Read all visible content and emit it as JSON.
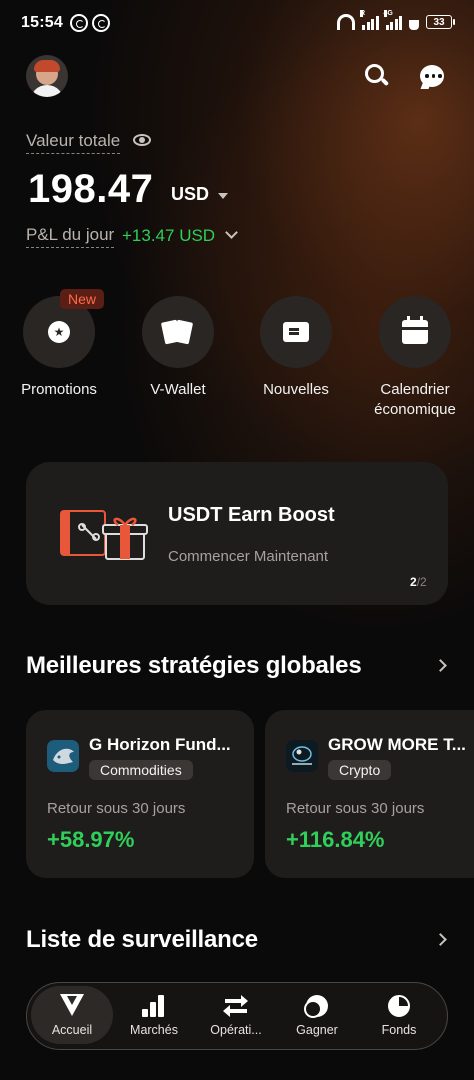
{
  "status_bar": {
    "time": "15:54",
    "network_tag_1": "R",
    "network_tag_2": "4G",
    "battery": "33"
  },
  "header": {
    "icons": [
      "avatar",
      "search-icon",
      "chat-icon"
    ]
  },
  "portfolio": {
    "total_label": "Valeur totale",
    "total_amount": "198.47",
    "currency": "USD",
    "pl_label": "P&L du jour",
    "pl_value": "+13.47 USD",
    "positive_color": "#2fcf5a"
  },
  "quick_actions": {
    "new_badge": "New",
    "items": [
      {
        "label": "Promotions",
        "icon": "star-icon"
      },
      {
        "label": "V-Wallet",
        "icon": "wallet-icon"
      },
      {
        "label": "Nouvelles",
        "icon": "news-icon"
      },
      {
        "label": "Calendrier économique",
        "icon": "calendar-icon"
      }
    ]
  },
  "promo": {
    "title": "USDT Earn Boost",
    "subtitle": "Commencer Maintenant",
    "pager_current": "2",
    "pager_total": "/2",
    "accent": "#e8573a"
  },
  "strategies": {
    "title": "Meilleures stratégies globales",
    "cards": [
      {
        "name": "G Horizon Fund...",
        "tag": "Commodities",
        "return_label": "Retour sous 30 jours",
        "return_value": "+58.97%"
      },
      {
        "name": "GROW MORE T...",
        "tag": "Crypto",
        "return_label": "Retour sous 30 jours",
        "return_value": "+116.84%"
      }
    ]
  },
  "watchlist": {
    "title": "Liste de surveillance"
  },
  "bottom_nav": {
    "items": [
      {
        "label": "Accueil",
        "active": true
      },
      {
        "label": "Marchés",
        "active": false
      },
      {
        "label": "Opérati...",
        "active": false
      },
      {
        "label": "Gagner",
        "active": false
      },
      {
        "label": "Fonds",
        "active": false
      }
    ]
  }
}
